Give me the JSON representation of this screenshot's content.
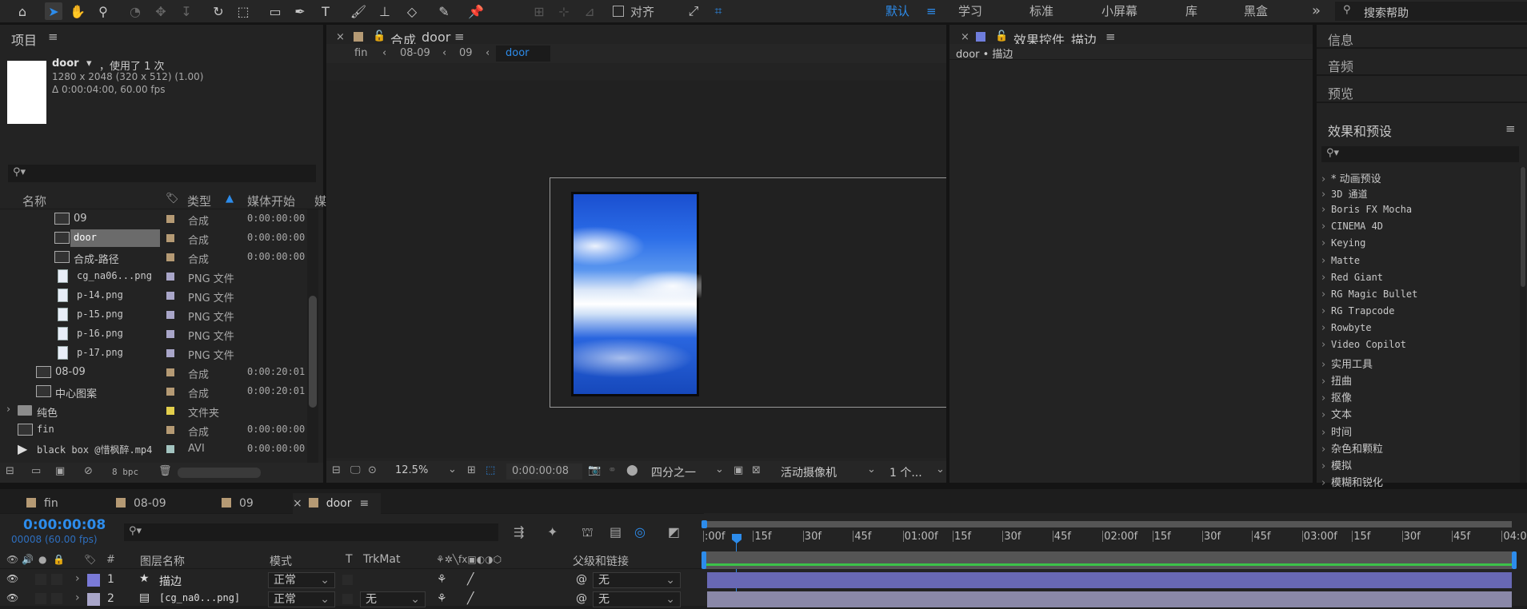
{
  "toolbar": {
    "align_label": "对齐",
    "workspaces": [
      "默认",
      "学习",
      "标准",
      "小屏幕",
      "库",
      "黑盒"
    ],
    "overflow": "»",
    "search_help": "搜索帮助"
  },
  "project": {
    "title": "项目",
    "preview": {
      "name": "door",
      "used": "，使用了 1 次",
      "dims": "1280 x 2048  (320 x 512) (1.00)",
      "duration": "Δ 0:00:04:00, 60.00 fps"
    },
    "columns": {
      "name": "名称",
      "type": "类型",
      "start": "媒体开始",
      "more": "媒"
    },
    "rows": [
      {
        "name": "09",
        "type": "合成",
        "start": "0:00:00:00",
        "label_color": "#b59a74",
        "icon": "comp"
      },
      {
        "name": "door",
        "type": "合成",
        "start": "0:00:00:00",
        "label_color": "#b59a74",
        "icon": "comp",
        "selected": true
      },
      {
        "name": "合成-路径",
        "type": "合成",
        "start": "0:00:00:00",
        "label_color": "#b59a74",
        "icon": "comp"
      },
      {
        "name": "cg_na06...png",
        "type": "PNG 文件",
        "start": "",
        "label_color": "#a9a6c9",
        "icon": "png"
      },
      {
        "name": "p-14.png",
        "type": "PNG 文件",
        "start": "",
        "label_color": "#a9a6c9",
        "icon": "png"
      },
      {
        "name": "p-15.png",
        "type": "PNG 文件",
        "start": "",
        "label_color": "#a9a6c9",
        "icon": "png"
      },
      {
        "name": "p-16.png",
        "type": "PNG 文件",
        "start": "",
        "label_color": "#a9a6c9",
        "icon": "png"
      },
      {
        "name": "p-17.png",
        "type": "PNG 文件",
        "start": "",
        "label_color": "#a9a6c9",
        "icon": "png"
      },
      {
        "name": "08-09",
        "type": "合成",
        "start": "0:00:20:01",
        "label_color": "#b59a74",
        "icon": "comp"
      },
      {
        "name": "中心图案",
        "type": "合成",
        "start": "0:00:20:01",
        "label_color": "#b59a74",
        "icon": "comp"
      },
      {
        "name": "纯色",
        "type": "文件夹",
        "start": "",
        "label_color": "#e3cf4c",
        "icon": "folder"
      },
      {
        "name": "fin",
        "type": "合成",
        "start": "0:00:00:00",
        "label_color": "#b59a74",
        "icon": "comp"
      },
      {
        "name": "black box @惜枫醉.mp4",
        "type": "AVI",
        "start": "0:00:00:00",
        "label_color": "#a3c4c0",
        "icon": "video"
      }
    ],
    "bpc": "8 bpc"
  },
  "composition": {
    "tab_label": "合成",
    "tab_name": "door",
    "breadcrumbs": [
      "fin",
      "08-09",
      "09",
      "door"
    ],
    "zoom": "12.5%",
    "timecode": "0:00:00:08",
    "resolution": "四分之一",
    "camera": "活动摄像机",
    "views": "1 个..."
  },
  "effects": {
    "tab_label": "效果控件",
    "tab_name": "描边",
    "path": "door • 描边"
  },
  "right_panels": {
    "info": "信息",
    "audio": "音频",
    "preview": "预览",
    "effects_presets": "效果和预设",
    "items": [
      "* 动画预设",
      "3D 通道",
      "Boris FX Mocha",
      "CINEMA 4D",
      "Keying",
      "Matte",
      "Red Giant",
      "RG Magic Bullet",
      "RG Trapcode",
      "Rowbyte",
      "Video Copilot",
      "实用工具",
      "扭曲",
      "抠像",
      "文本",
      "时间",
      "杂色和颗粒",
      "模拟",
      "模糊和锐化"
    ]
  },
  "timeline": {
    "tabs": [
      "fin",
      "08-09",
      "09",
      "door"
    ],
    "timecode": "0:00:00:08",
    "frame_info": "00008 (60.00 fps)",
    "headers": {
      "layer_name": "图层名称",
      "mode": "模式",
      "t": "T",
      "trkmat": "TrkMat",
      "parent": "父级和链接"
    },
    "ruler": [
      ":00f",
      "15f",
      "30f",
      "45f",
      "01:00f",
      "15f",
      "30f",
      "45f",
      "02:00f",
      "15f",
      "30f",
      "45f",
      "03:00f",
      "15f",
      "30f",
      "45f",
      "04:0"
    ],
    "layers": [
      {
        "num": "1",
        "name": "描边",
        "mode": "正常",
        "trkmat": "",
        "parent": "无",
        "color": "#7a7ad8"
      },
      {
        "num": "2",
        "name": "[cg_na0...png]",
        "mode": "正常",
        "trkmat": "无",
        "parent": "无",
        "color": "#a9a6c9"
      }
    ]
  }
}
